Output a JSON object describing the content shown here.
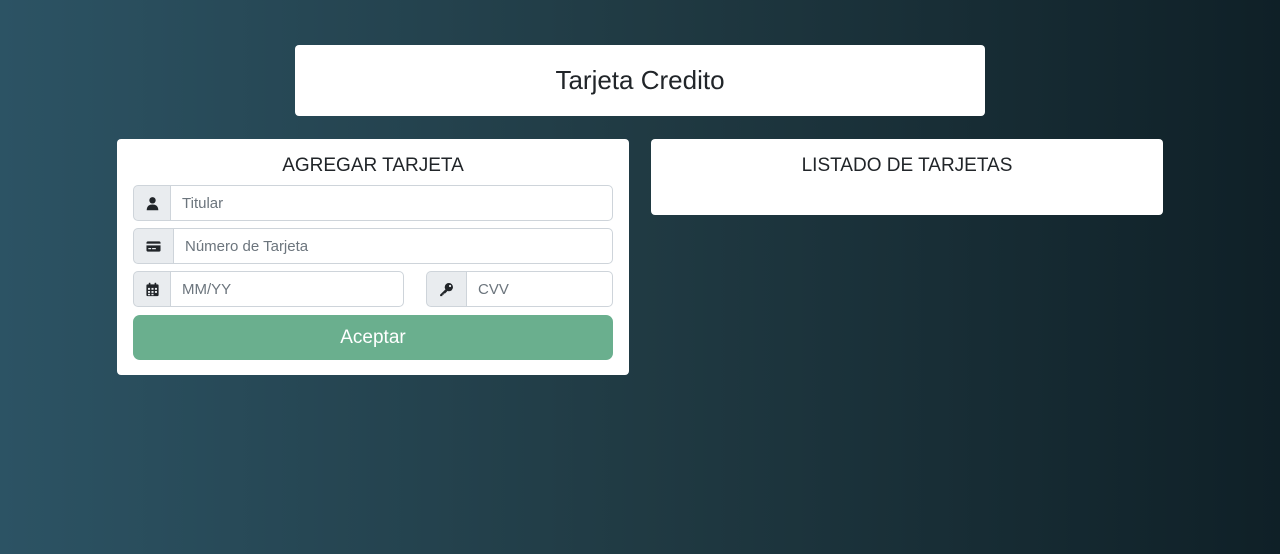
{
  "header": {
    "title": "Tarjeta Credito"
  },
  "add_card": {
    "title": "AGREGAR TARJETA",
    "holder": {
      "placeholder": "Titular",
      "value": "",
      "icon": "user-icon"
    },
    "number": {
      "placeholder": "Número de Tarjeta",
      "value": "",
      "icon": "credit-card-icon"
    },
    "expiry": {
      "placeholder": "MM/YY",
      "value": "",
      "icon": "calendar-icon"
    },
    "cvv": {
      "placeholder": "CVV",
      "value": "",
      "icon": "key-icon"
    },
    "submit_label": "Aceptar"
  },
  "card_list": {
    "title": "LISTADO DE TARJETAS",
    "items": []
  },
  "colors": {
    "background_gradient": [
      "#2c5364",
      "#203a43",
      "#0f2027"
    ],
    "button_accent": "#6aaf8e",
    "card_background": "#ffffff",
    "addon_background": "#e9ecef"
  }
}
